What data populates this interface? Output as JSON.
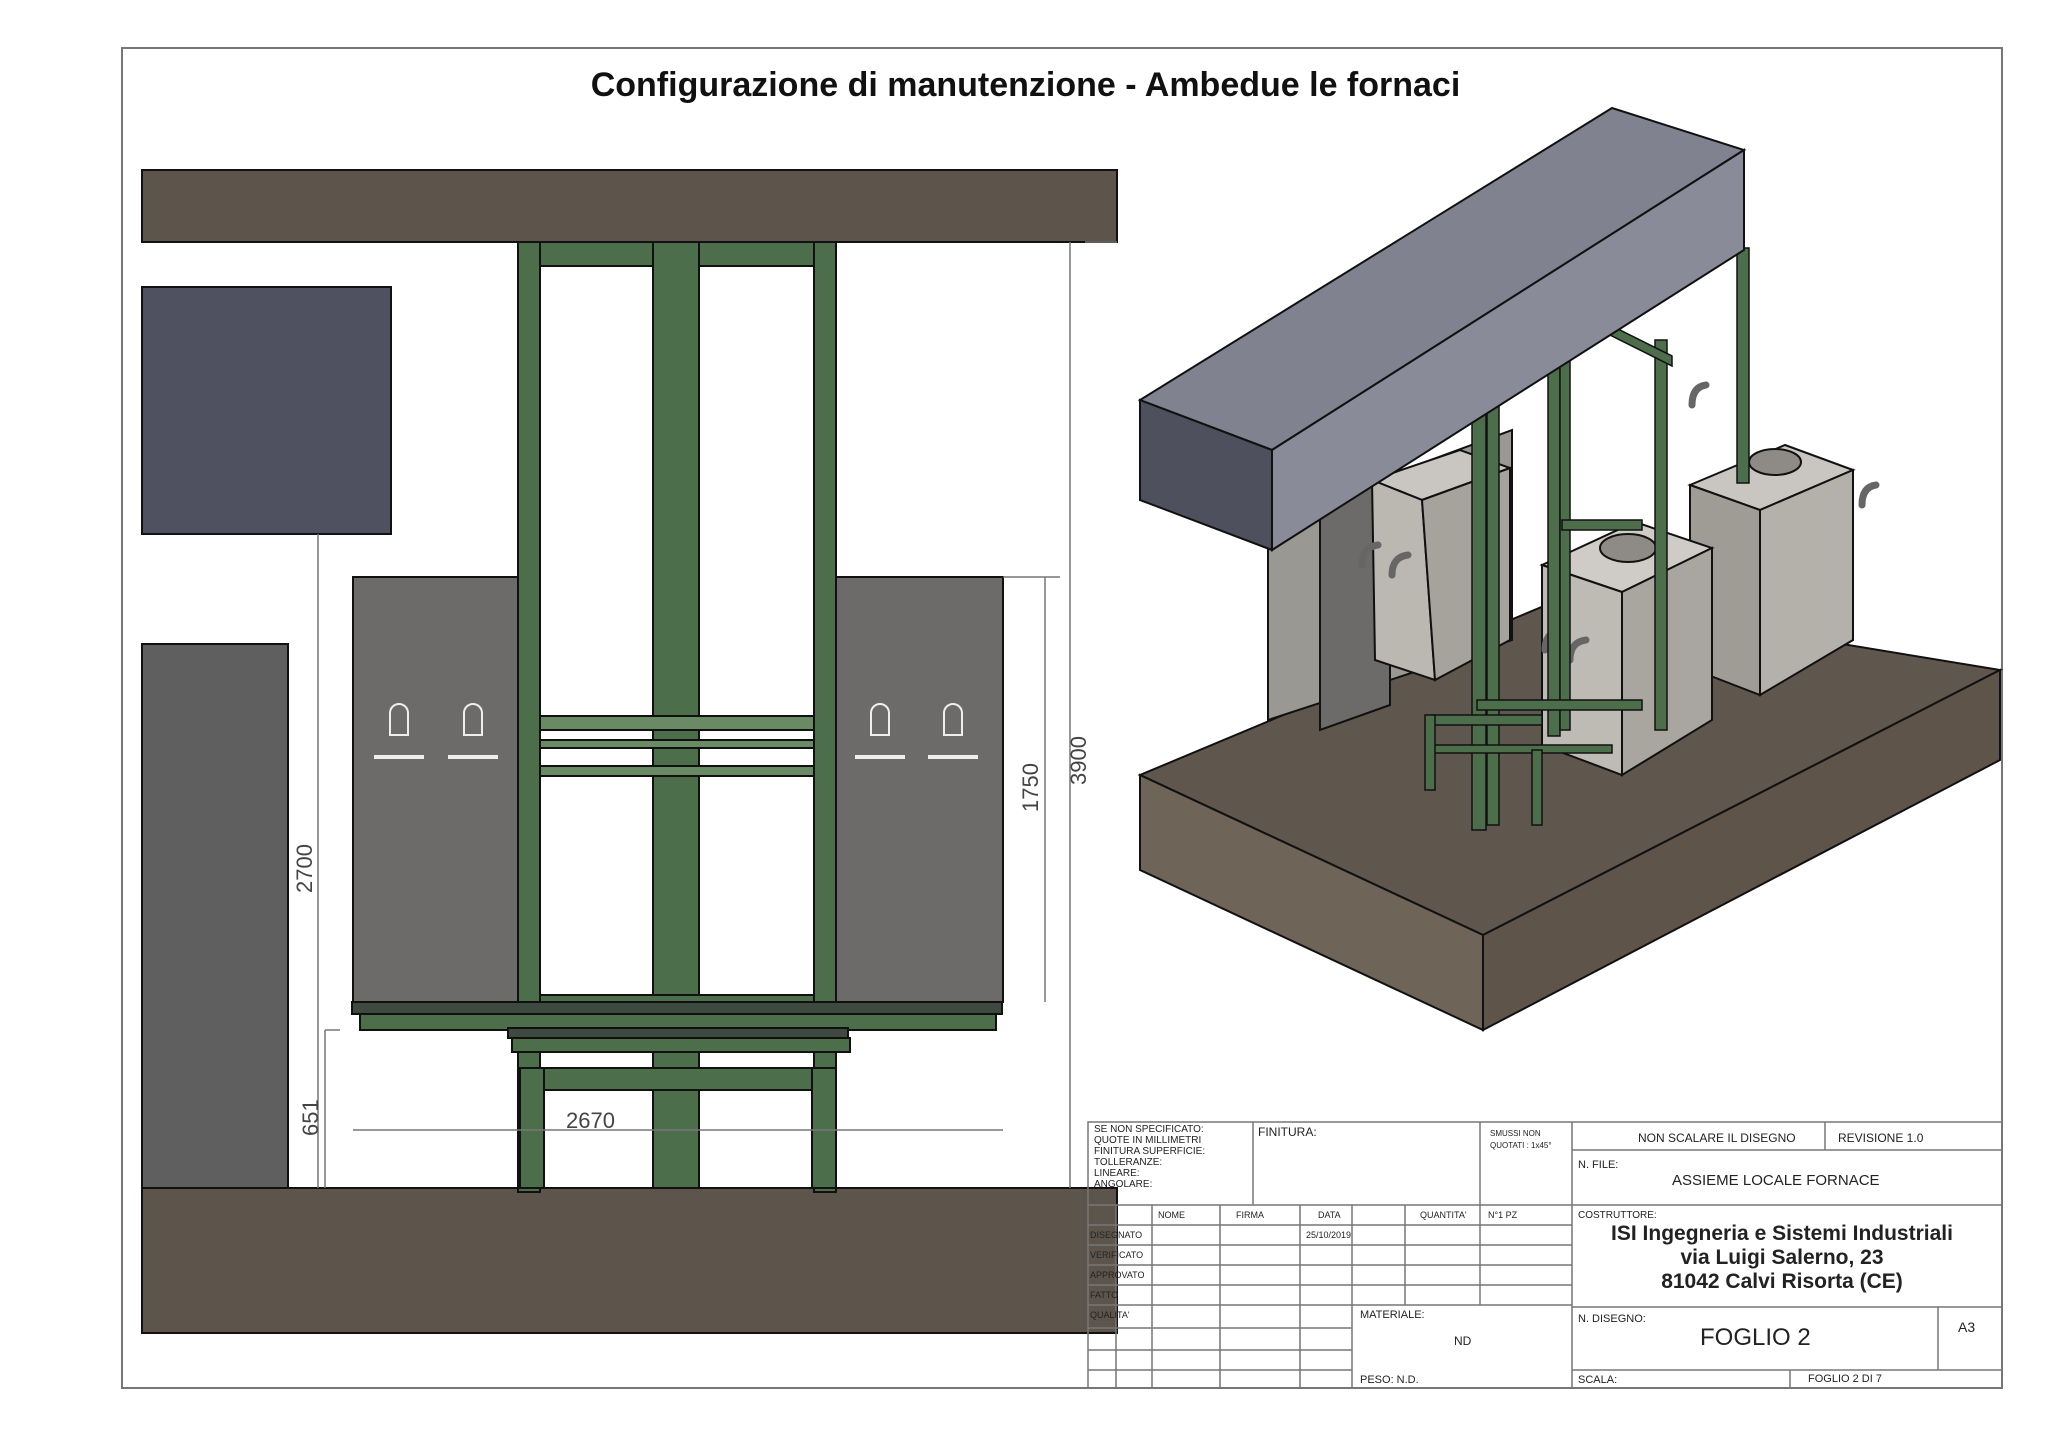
{
  "title": "Configurazione di manutenzione - Ambedue le fornaci",
  "dimensions": {
    "d2700": "2700",
    "d1750": "1750",
    "d3900": "3900",
    "d651": "651",
    "d2670": "2670"
  },
  "title_block": {
    "general_notes": [
      "SE NON SPECIFICATO:",
      "QUOTE IN MILLIMETRI",
      "FINITURA SUPERFICIE:",
      "TOLLERANZE:",
      "LINEARE:",
      "ANGOLARE:"
    ],
    "finitura": "FINITURA:",
    "smussi": [
      "SMUSSI NON",
      "QUOTATI : 1x45°"
    ],
    "non_scalare": "NON SCALARE IL DISEGNO",
    "revisione": "REVISIONE 1.0",
    "n_file_label": "N. FILE:",
    "n_file_value": "ASSIEME LOCALE FORNACE",
    "costruttore_label": "COSTRUTTORE:",
    "costruttore_lines": [
      "ISI Ingegneria e Sistemi Industriali",
      "via Luigi Salerno, 23",
      "81042 Calvi Risorta (CE)"
    ],
    "col_headers": [
      "NOME",
      "FIRMA",
      "DATA",
      "QUANTITA'",
      "N°1 PZ"
    ],
    "row_labels": [
      "DISEGNATO",
      "VERIFICATO",
      "APPROVATO",
      "FATTO",
      "QUALITA'"
    ],
    "data_disegnato": "25/10/2019",
    "materiale_label": "MATERIALE:",
    "materiale_value": "ND",
    "n_disegno_label": "N. DISEGNO:",
    "n_disegno_value": "FOGLIO 2",
    "formato": "A3",
    "peso": "PESO: N.D.",
    "scala": "SCALA:",
    "foglio": "FOGLIO 2 DI 7"
  },
  "colors": {
    "beam": "#5d554c",
    "frame_green": "#4d6e4a",
    "furnace": "#6d6b6a",
    "panel": "#4f5160",
    "iso_beam_top": "#81828f",
    "iso_beam_side": "#4f505e",
    "iso_floor_top": "#5f574d",
    "iso_floor_side": "#6f6458"
  }
}
